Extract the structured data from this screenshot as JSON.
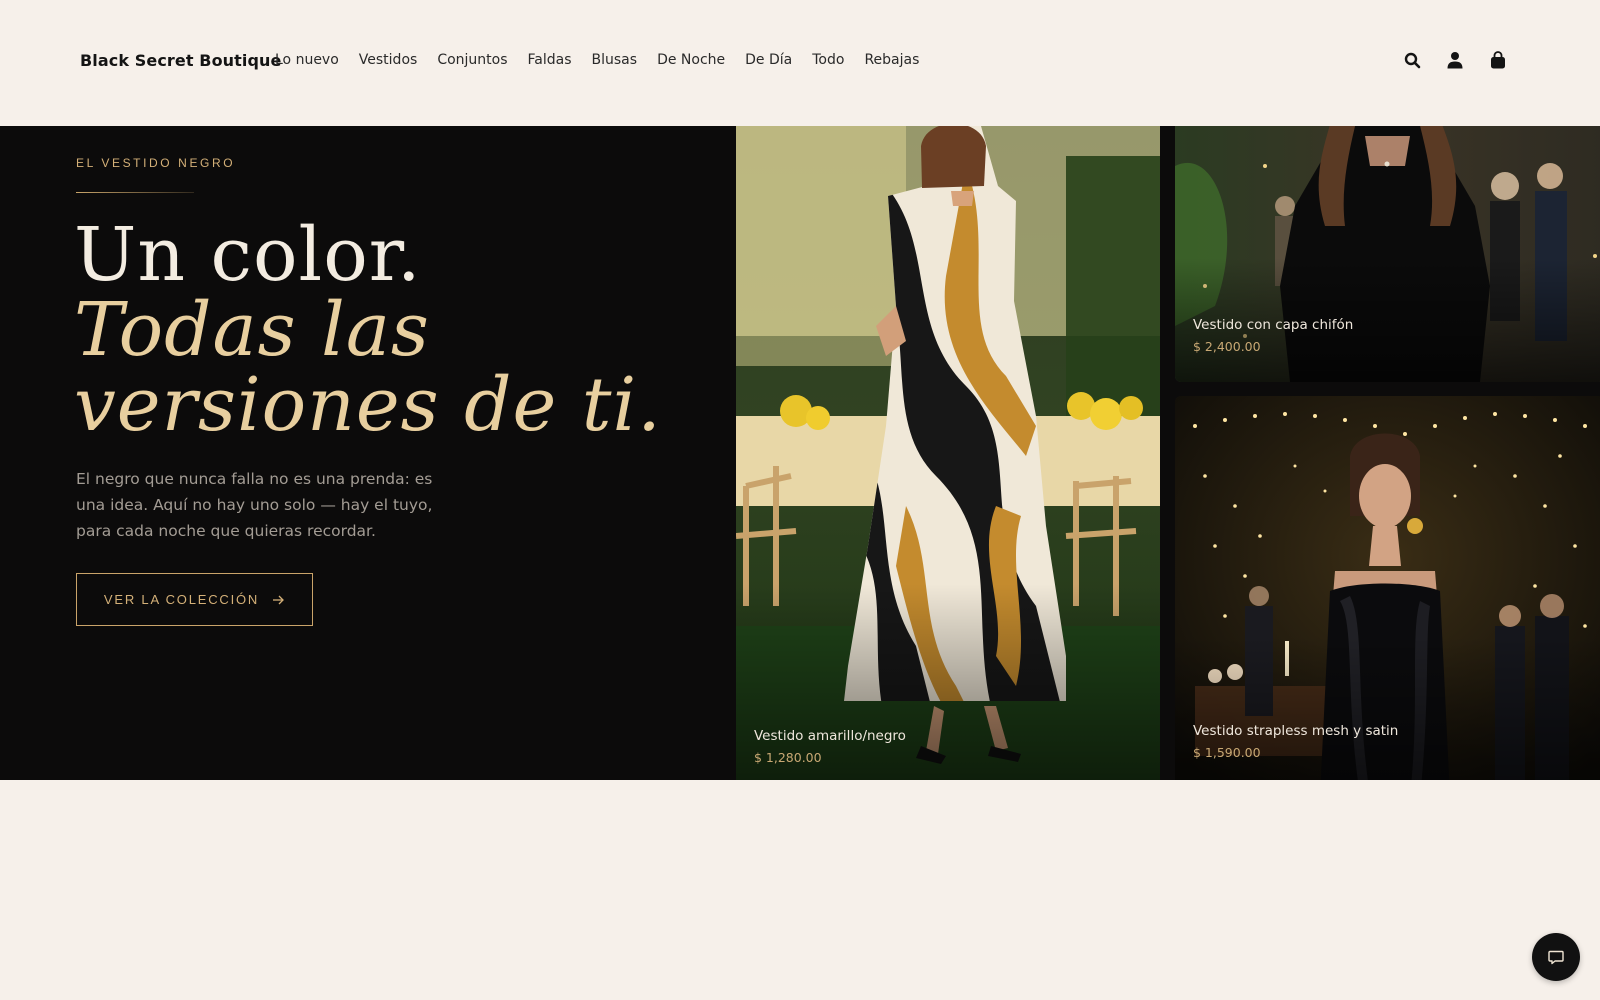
{
  "header": {
    "brand": "Black Secret Boutique",
    "nav": [
      "Lo nuevo",
      "Vestidos",
      "Conjuntos",
      "Faldas",
      "Blusas",
      "De Noche",
      "De Día",
      "Todo",
      "Rebajas"
    ],
    "icons": [
      "search-icon",
      "account-icon",
      "bag-icon"
    ]
  },
  "hero": {
    "eyebrow": "EL VESTIDO NEGRO",
    "headline_line1": "Un color.",
    "headline_line2": "Todas las",
    "headline_line3": "versiones de ti.",
    "description": "El negro que nunca falla no es una prenda: es una idea. Aquí no hay uno solo — hay el tuyo, para cada noche que quieras recordar.",
    "cta_label": "VER LA COLECCIÓN",
    "cta_icon": "arrow-right-icon"
  },
  "products": [
    {
      "name": "Vestido amarillo/negro",
      "price": "$ 1,280.00"
    },
    {
      "name": "Vestido con capa chifón",
      "price": "$ 2,400.00"
    },
    {
      "name": "Vestido strapless mesh y satin",
      "price": "$ 1,590.00"
    }
  ],
  "chat": {
    "icon": "chat-icon"
  },
  "colors": {
    "background": "#f6f0ea",
    "hero_background": "#0c0b0b",
    "accent_gold": "#d4b078",
    "headline_cream": "#f3ece1",
    "headline_gold": "#e8cf9f"
  }
}
